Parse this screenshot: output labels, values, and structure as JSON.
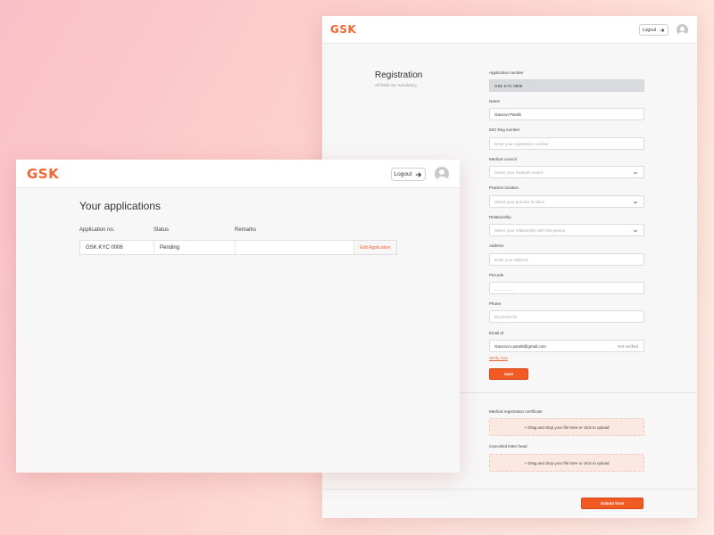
{
  "brand": {
    "logo_text": "GSK",
    "accent": "#f36633"
  },
  "header": {
    "logout_label": "Logout"
  },
  "registration": {
    "title": "Registration",
    "subtitle": "All fields are mandatory",
    "fields": {
      "app_number": {
        "label": "Application number",
        "value": "GSK KYC 0006"
      },
      "name": {
        "label": "Name",
        "value": "Gaurovi Pandit"
      },
      "mci": {
        "label": "MCI Reg number",
        "placeholder": "Enter your registration number"
      },
      "council": {
        "label": "Medical council",
        "placeholder": "Select your medical council"
      },
      "location": {
        "label": "Practice location",
        "placeholder": "Select your practice location"
      },
      "relationship": {
        "label": "Relationship",
        "placeholder": "Select your relationship with this person"
      },
      "address": {
        "label": "Address",
        "placeholder": "Enter your address"
      },
      "pincode": {
        "label": "Pincode",
        "placeholder": "_ _ _ _ _ _"
      },
      "phone": {
        "label": "Phone",
        "placeholder": "9142018732"
      },
      "email": {
        "label": "Email id",
        "value": "Gaurovi.s.pandit@gmail.com",
        "status": "Not verified"
      }
    },
    "verify_label": "Verify now",
    "save_label": "Save",
    "uploads": {
      "certificate": {
        "label": "Medical registration certificate",
        "hint": "+ Drag and drop your file here or click to upload"
      },
      "letterhead": {
        "label": "Cancelled letter head",
        "hint": "+ Drag and drop your file here or click to upload"
      }
    },
    "submit_label": "Submit form"
  },
  "applications": {
    "title": "Your applications",
    "columns": {
      "app_no": "Application no.",
      "status": "Status",
      "remarks": "Remarks"
    },
    "rows": [
      {
        "app_no": "GSK KYC 0006",
        "status": "Pending",
        "remarks": "",
        "action": "Edit Application"
      }
    ]
  }
}
